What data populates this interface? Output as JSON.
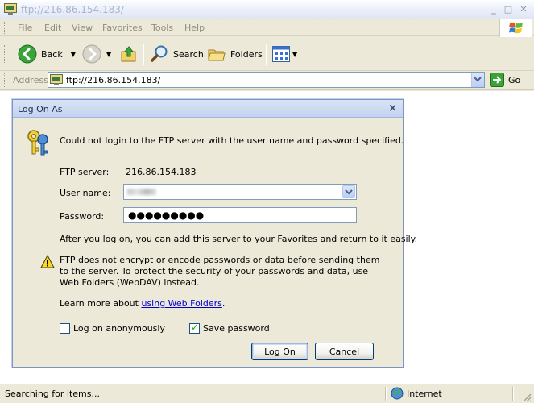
{
  "window": {
    "title": "ftp://216.86.154.183/",
    "minimize_glyph": "_",
    "maximize_glyph": "□",
    "close_glyph": "✕"
  },
  "menu": [
    "File",
    "Edit",
    "View",
    "Favorites",
    "Tools",
    "Help"
  ],
  "toolbar": {
    "back_label": "Back",
    "search_label": "Search",
    "folders_label": "Folders"
  },
  "address": {
    "label": "Address",
    "value": "ftp://216.86.154.183/",
    "go_label": "Go"
  },
  "dialog": {
    "title": "Log On As",
    "close_glyph": "×",
    "error_message": "Could not login to the FTP server with the user name and password specified.",
    "ftp_server_label": "FTP server:",
    "ftp_server_value": "216.86.154.183",
    "username_label": "User name:",
    "password_label": "Password:",
    "password_value": "●●●●●●●●●",
    "after_logon_text": "After you log on, you can add this server to your Favorites and return to it easily.",
    "warning_text": "FTP does not encrypt or encode passwords or data before sending them to the server.  To protect the security of your passwords and data, use Web Folders (WebDAV) instead.",
    "learn_more_text": "Learn more about ",
    "learn_more_link": "using Web Folders",
    "learn_more_end": ".",
    "anonymous_label": "Log on anonymously",
    "anonymous_checked": false,
    "save_password_label": "Save password",
    "save_password_checked": true,
    "logon_button": "Log On",
    "cancel_button": "Cancel"
  },
  "status": {
    "text": "Searching for items...",
    "zone": "Internet"
  },
  "colors": {
    "xp_face": "#ECE9D8",
    "dialog_border": "#7a96c9",
    "link": "#0000cc"
  }
}
